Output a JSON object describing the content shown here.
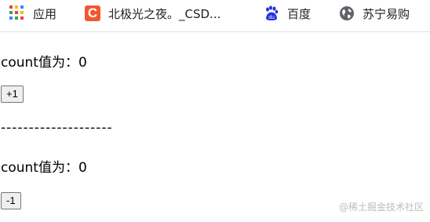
{
  "bookmarks": {
    "apps_label": "应用",
    "csdn_label": "北极光之夜。_CSD...",
    "baidu_label": "百度",
    "suning_label": "苏宁易购"
  },
  "main": {
    "count_label_1": "count值为：0",
    "plus_button": "+1",
    "divider": "--------------------",
    "count_label_2": "count值为：0",
    "minus_button": "-1"
  },
  "watermark": "@稀土掘金技术社区",
  "colors": {
    "csdn_icon": "#f2572d",
    "baidu_icon": "#2932e1",
    "suning_icon": "#5f6368"
  },
  "icons": {
    "apps": "apps-grid-icon",
    "csdn": "csdn-c-icon",
    "baidu": "baidu-paw-icon",
    "suning": "globe-icon"
  }
}
